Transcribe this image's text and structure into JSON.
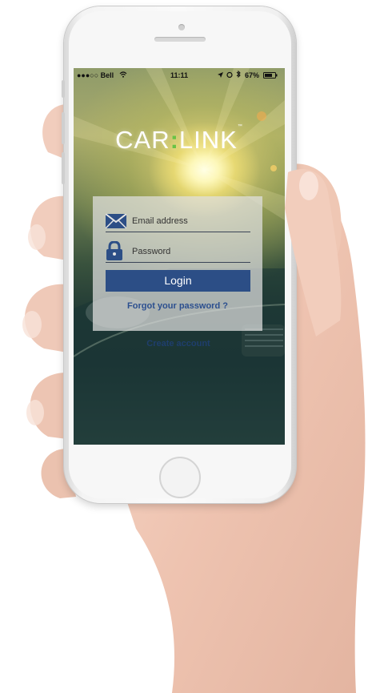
{
  "status_bar": {
    "carrier": "●●●○○ Bell",
    "time": "11:11",
    "battery": "67%"
  },
  "brand": {
    "logo_part1": "CAR",
    "logo_dots": ":",
    "logo_part2": "LINK",
    "logo_tm": "™",
    "accent_color": "#69c245"
  },
  "login_form": {
    "email_placeholder": "Email address",
    "password_placeholder": "Password",
    "login_label": "Login",
    "forgot_label": "Forgot your password ?",
    "button_color": "#2c4e86"
  },
  "footer": {
    "create_account_label": "Create account"
  },
  "icons": [
    "envelope-icon",
    "lock-icon",
    "wifi-icon",
    "location-arrow-icon",
    "alarm-icon",
    "bluetooth-icon",
    "battery-icon"
  ]
}
